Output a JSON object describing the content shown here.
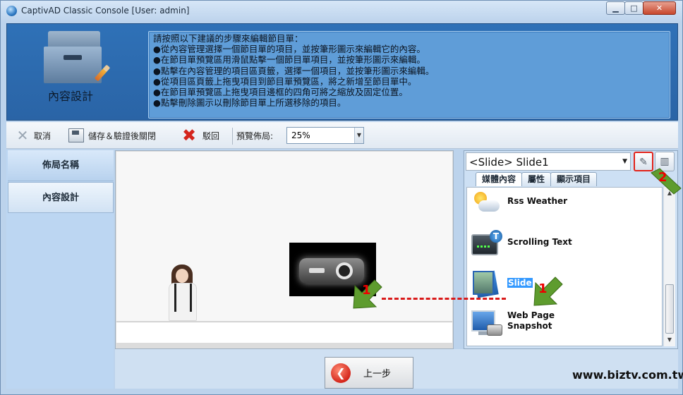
{
  "window": {
    "title": "CaptivAD Classic Console [User: admin]",
    "controls": {
      "minimize": "▁",
      "maximize": "□",
      "close": "✕"
    }
  },
  "header": {
    "section_title": "內容設計",
    "instructions": [
      "請按照以下建議的步驟來編輯節目單：",
      "●從內容管理選擇一個節目單的項目，並按筆形圖示來編輯它的內容。",
      "●在節目單預覽區用滑鼠點擊一個節目單項目，並按筆形圖示來編輯。",
      "●點擊在內容管理的項目區頁籤，選擇一個項目，並按筆形圖示來編輯。",
      "●從項目區頁籤上拖曳項目到節目單預覽區，將之新增至節目單中。",
      "●在節目單預覽區上拖曳項目邊框的四角可將之縮放及固定位置。",
      "●點擊刪除圖示以刪除節目單上所選移除的項目。"
    ]
  },
  "toolbar": {
    "cancel_label": "取消",
    "save_close_label": "儲存＆驗證後關閉",
    "reject_label": "駁回",
    "zoom_label": "預覽佈局:",
    "zoom_value": "25%"
  },
  "nav": {
    "items": [
      {
        "label": "佈局名稱",
        "active": false
      },
      {
        "label": "內容設計",
        "active": true
      }
    ]
  },
  "right_panel": {
    "selected": "<Slide> Slide1",
    "tabs": [
      "媒體內容",
      "屬性",
      "顯示項目"
    ],
    "active_tab": "媒體內容",
    "items": [
      {
        "label": "Rss Weather",
        "icon": "rss-weather-icon"
      },
      {
        "label": "Scrolling Text",
        "icon": "scrolling-text-icon"
      },
      {
        "label": "Slide",
        "icon": "slide-icon",
        "selected": true
      },
      {
        "label": "Web Page",
        "label2": "Snapshot",
        "icon": "web-page-snapshot-icon"
      }
    ]
  },
  "footer": {
    "prev_label": "上一步",
    "website": "www.biztv.com.tw"
  },
  "annotations": {
    "step1": "1",
    "step2": "2"
  }
}
